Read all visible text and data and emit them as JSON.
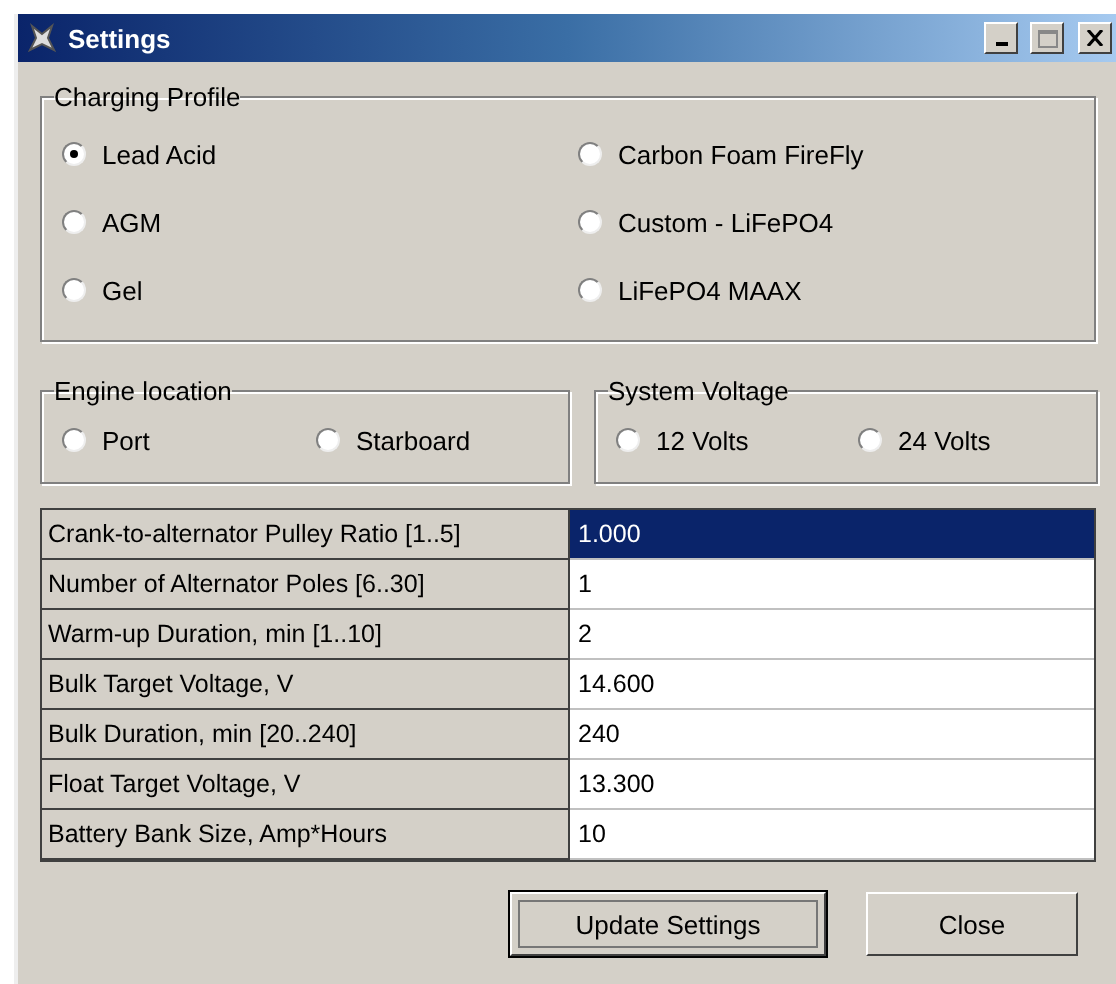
{
  "window": {
    "title": "Settings"
  },
  "charging_profile": {
    "title": "Charging Profile",
    "options": [
      {
        "label": "Lead Acid",
        "selected": true
      },
      {
        "label": "Carbon Foam FireFly",
        "selected": false
      },
      {
        "label": "AGM",
        "selected": false
      },
      {
        "label": "Custom - LiFePO4",
        "selected": false
      },
      {
        "label": "Gel",
        "selected": false
      },
      {
        "label": "LiFePO4 MAAX",
        "selected": false
      }
    ]
  },
  "engine_location": {
    "title": "Engine location",
    "options": [
      {
        "label": "Port",
        "selected": false
      },
      {
        "label": "Starboard",
        "selected": false
      }
    ]
  },
  "system_voltage": {
    "title": "System Voltage",
    "options": [
      {
        "label": "12 Volts",
        "selected": false
      },
      {
        "label": "24 Volts",
        "selected": false
      }
    ]
  },
  "table": {
    "rows": [
      {
        "name": "Crank-to-alternator Pulley Ratio [1..5]",
        "value": "1.000",
        "selected": true
      },
      {
        "name": "Number of Alternator Poles [6..30]",
        "value": "1",
        "selected": false
      },
      {
        "name": "Warm-up Duration, min [1..10]",
        "value": "2",
        "selected": false
      },
      {
        "name": "Bulk Target Voltage, V",
        "value": "14.600",
        "selected": false
      },
      {
        "name": "Bulk Duration, min [20..240]",
        "value": "240",
        "selected": false
      },
      {
        "name": "Float Target Voltage, V",
        "value": "13.300",
        "selected": false
      },
      {
        "name": "Battery Bank Size, Amp*Hours",
        "value": "10",
        "selected": false
      }
    ]
  },
  "buttons": [
    {
      "label": "Update Settings",
      "focused": true
    },
    {
      "label": "Close",
      "focused": false
    }
  ]
}
